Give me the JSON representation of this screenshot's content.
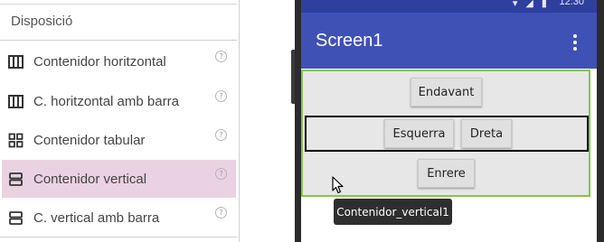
{
  "palette": {
    "header": "Disposició",
    "help_glyph": "?",
    "items": [
      {
        "label": "Contenidor horitzontal",
        "icon": "horizontal-arrangement-icon",
        "selected": false
      },
      {
        "label": "C. horitzontal amb barra",
        "icon": "horizontal-scroll-arrangement-icon",
        "selected": false
      },
      {
        "label": "Contenidor tabular",
        "icon": "table-arrangement-icon",
        "selected": false
      },
      {
        "label": "Contenidor vertical",
        "icon": "vertical-arrangement-icon",
        "selected": true
      },
      {
        "label": "C. vertical amb barra",
        "icon": "vertical-scroll-arrangement-icon",
        "selected": false
      }
    ]
  },
  "phone": {
    "status_time": "12:30",
    "screen_title": "Screen1",
    "buttons": {
      "forward": "Endavant",
      "left": "Esquerra",
      "right": "Dreta",
      "back": "Enrere"
    }
  },
  "tooltip": {
    "text": "Contenidor_vertical1"
  },
  "colors": {
    "toolbar": "#3f51b5",
    "statusbar": "#2f3f9e",
    "selection_highlight": "#ead2e2",
    "selected_component_border": "#8bc34a"
  }
}
